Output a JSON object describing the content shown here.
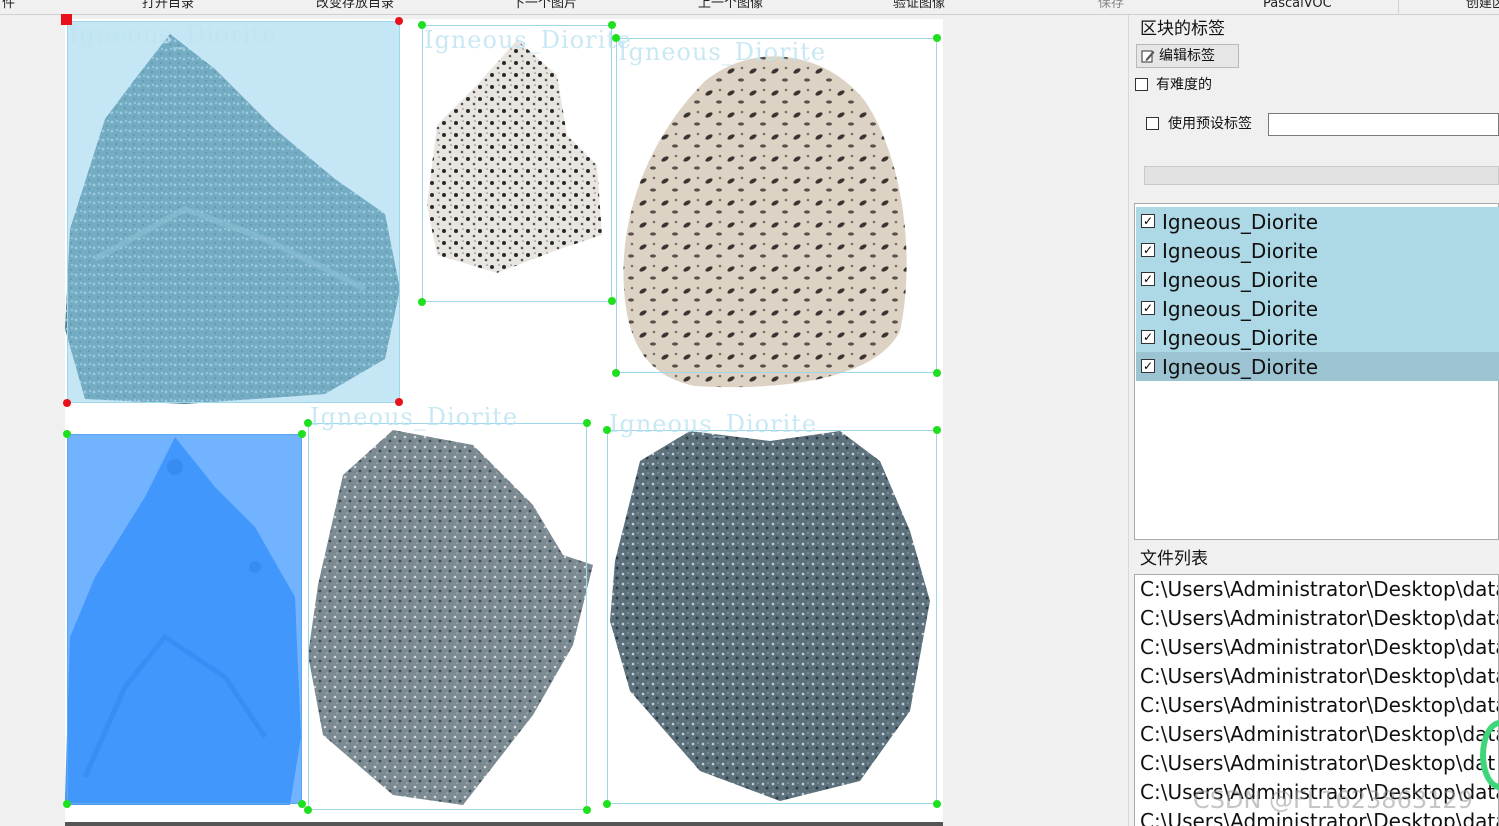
{
  "toolbar": {
    "items": [
      "件",
      "打开目录",
      "改变存放目录",
      "下一个图片",
      "上一个图像",
      "验证图像",
      "保存",
      "PascalVOC",
      "创建区"
    ]
  },
  "canvas": {
    "shape_label": "Igneous_Diorite"
  },
  "label_panel": {
    "title": "区块的标签",
    "edit_button": "编辑标签",
    "difficult_label": "有难度的",
    "use_preset_label": "使用预设标签",
    "preset_value": "",
    "labels": [
      {
        "text": "Igneous_Diorite",
        "checked": true,
        "selected": false
      },
      {
        "text": "Igneous_Diorite",
        "checked": true,
        "selected": false
      },
      {
        "text": "Igneous_Diorite",
        "checked": true,
        "selected": false
      },
      {
        "text": "Igneous_Diorite",
        "checked": true,
        "selected": false
      },
      {
        "text": "Igneous_Diorite",
        "checked": true,
        "selected": false
      },
      {
        "text": "Igneous_Diorite",
        "checked": true,
        "selected": true
      }
    ]
  },
  "file_panel": {
    "title": "文件列表",
    "files": [
      "C:\\Users\\Administrator\\Desktop\\data\\",
      "C:\\Users\\Administrator\\Desktop\\data\\",
      "C:\\Users\\Administrator\\Desktop\\data\\",
      "C:\\Users\\Administrator\\Desktop\\data\\",
      "C:\\Users\\Administrator\\Desktop\\data\\",
      "C:\\Users\\Administrator\\Desktop\\data\\",
      "C:\\Users\\Administrator\\Desktop\\dat",
      "C:\\Users\\Administrator\\Desktop\\data\\",
      "C:\\Users\\Administrator\\Desktop\\data\\"
    ]
  },
  "watermark": "CSDN @FL1623863129",
  "colors": {
    "box_stroke": "#9ed6ea",
    "vertex": "#1fe01f",
    "selected_vertex": "#e8101a",
    "label_row": "#add8e6",
    "selected_fill": "#3c96ff"
  }
}
